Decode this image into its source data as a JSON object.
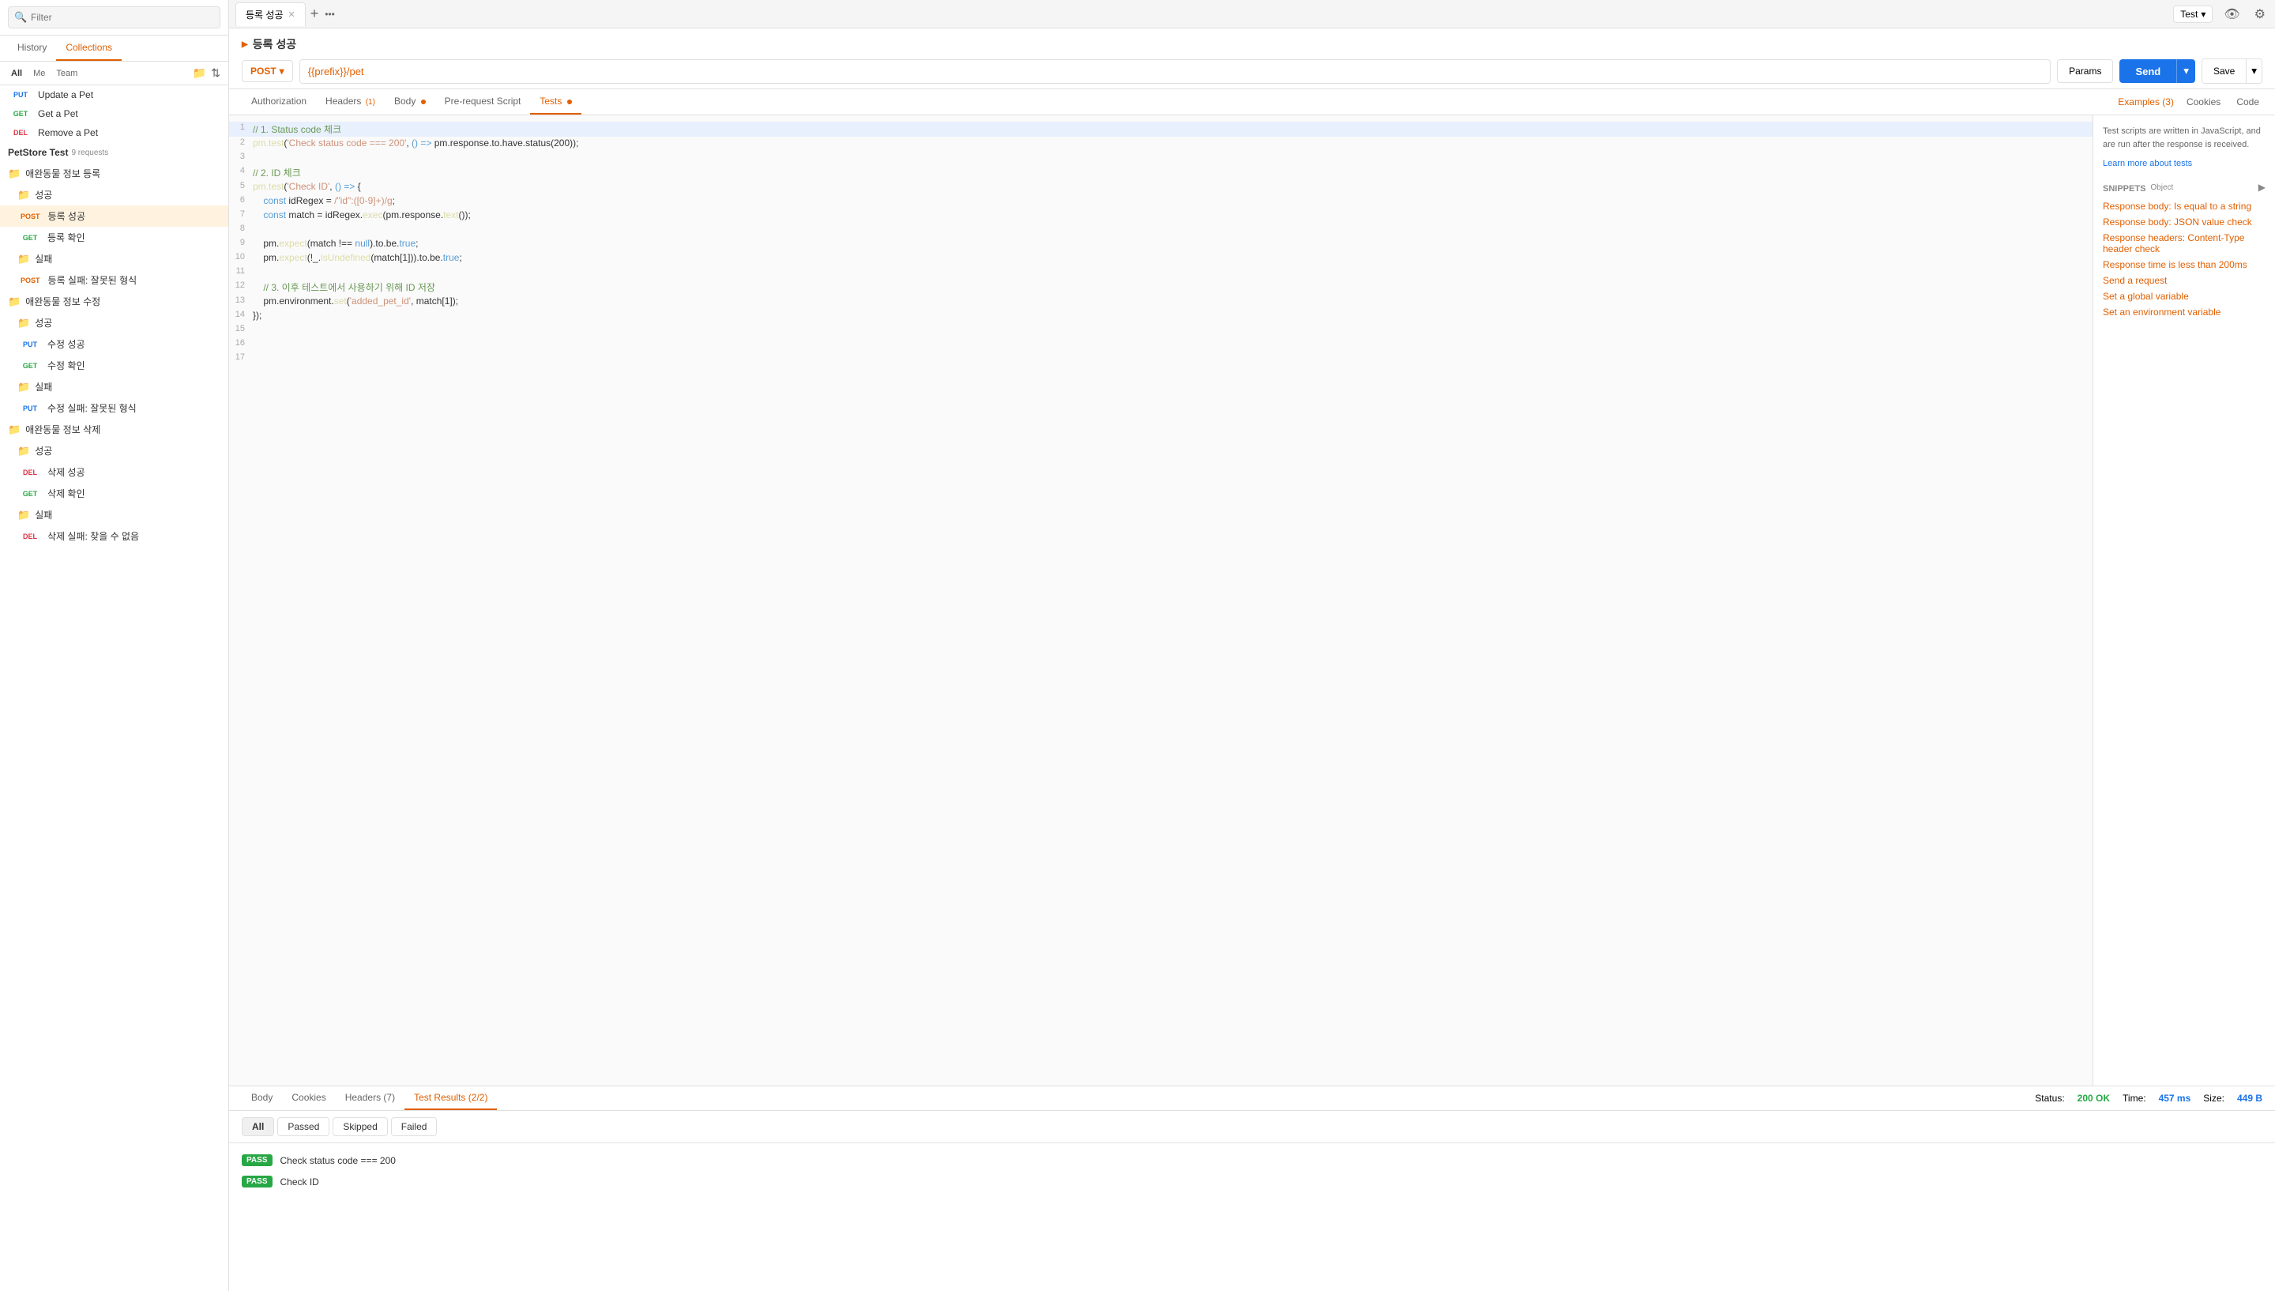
{
  "sidebar": {
    "search_placeholder": "Filter",
    "tabs": [
      {
        "label": "History",
        "active": false
      },
      {
        "label": "Collections",
        "active": true
      }
    ],
    "sub_tabs": [
      "All",
      "Me",
      "Team"
    ],
    "items": [
      {
        "type": "method",
        "method": "PUT",
        "name": "Update a Pet"
      },
      {
        "type": "method",
        "method": "GET",
        "name": "Get a Pet"
      },
      {
        "type": "method",
        "method": "DEL",
        "name": "Remove a Pet"
      },
      {
        "type": "section",
        "name": "PetStore Test",
        "count": "9 requests"
      },
      {
        "type": "folder",
        "name": "애완동물 정보 등록",
        "dots": true
      },
      {
        "type": "folder",
        "name": "성공"
      },
      {
        "type": "method",
        "method": "POST",
        "name": "등록 성공",
        "selected": true
      },
      {
        "type": "method",
        "method": "GET",
        "name": "등록 확인"
      },
      {
        "type": "folder",
        "name": "실패"
      },
      {
        "type": "method",
        "method": "POST",
        "name": "등록 실패: 잘못된 형식"
      },
      {
        "type": "folder",
        "name": "애완동물 정보 수정",
        "dots": true
      },
      {
        "type": "folder",
        "name": "성공",
        "dots": true
      },
      {
        "type": "method",
        "method": "PUT",
        "name": "수정 성공"
      },
      {
        "type": "method",
        "method": "GET",
        "name": "수정 확인"
      },
      {
        "type": "folder",
        "name": "실패",
        "dots": true
      },
      {
        "type": "method",
        "method": "PUT",
        "name": "수정 실패: 잘못된 형식"
      },
      {
        "type": "folder",
        "name": "애완동물 정보 삭제",
        "dots": true
      },
      {
        "type": "folder",
        "name": "성공",
        "dots": true
      },
      {
        "type": "method",
        "method": "DEL",
        "name": "삭제 성공"
      },
      {
        "type": "method",
        "method": "GET",
        "name": "삭제 확인"
      },
      {
        "type": "folder",
        "name": "실패"
      },
      {
        "type": "method",
        "method": "DEL",
        "name": "삭제 실패: 찾을 수 없음"
      }
    ]
  },
  "tabs": [
    {
      "label": "등록 성공",
      "active": true
    }
  ],
  "tab_add": "+",
  "tab_more": "•••",
  "env": {
    "label": "Test",
    "dropdown_icon": "▾"
  },
  "request": {
    "title": "등록 성공",
    "method": "POST",
    "url": "{{prefix}}/pet",
    "url_display": "{{prefix}}/pet",
    "params_label": "Params",
    "send_label": "Send",
    "save_label": "Save"
  },
  "req_tabs": [
    {
      "label": "Authorization",
      "active": false,
      "dot": false
    },
    {
      "label": "Headers",
      "active": false,
      "dot": false,
      "count": "1"
    },
    {
      "label": "Body",
      "active": false,
      "dot": true
    },
    {
      "label": "Pre-request Script",
      "active": false,
      "dot": false
    },
    {
      "label": "Tests",
      "active": true,
      "dot": true
    }
  ],
  "cookies_label": "Cookies",
  "code_label": "Code",
  "examples_label": "Examples (3)",
  "code_lines": [
    {
      "num": 1,
      "content": "// 1. Status code 체크",
      "type": "comment"
    },
    {
      "num": 2,
      "content": "pm.test('Check status code === 200', () => pm.response.to.have.status(200));",
      "type": "code"
    },
    {
      "num": 3,
      "content": "",
      "type": "empty"
    },
    {
      "num": 4,
      "content": "// 2. ID 체크",
      "type": "comment"
    },
    {
      "num": 5,
      "content": "pm.test('Check ID', () => {",
      "type": "code"
    },
    {
      "num": 6,
      "content": "    const idRegex = /\"id\":([0-9]+)/g;",
      "type": "code"
    },
    {
      "num": 7,
      "content": "    const match = idRegex.exec(pm.response.text());",
      "type": "code"
    },
    {
      "num": 8,
      "content": "",
      "type": "empty"
    },
    {
      "num": 9,
      "content": "    pm.expect(match !== null).to.be.true;",
      "type": "code"
    },
    {
      "num": 10,
      "content": "    pm.expect(!_.isUndefined(match[1])).to.be.true;",
      "type": "code"
    },
    {
      "num": 11,
      "content": "",
      "type": "empty"
    },
    {
      "num": 12,
      "content": "    // 3. 이후 테스트에서 사용하기 위해 ID 저장",
      "type": "comment"
    },
    {
      "num": 13,
      "content": "    pm.environment.set('added_pet_id', match[1]);",
      "type": "code"
    },
    {
      "num": 14,
      "content": "});",
      "type": "code"
    },
    {
      "num": 15,
      "content": "",
      "type": "empty"
    },
    {
      "num": 16,
      "content": "",
      "type": "empty"
    },
    {
      "num": 17,
      "content": "",
      "type": "empty"
    }
  ],
  "snippets": {
    "desc": "Test scripts are written in JavaScript, and are run after the response is received.",
    "learn_more": "Learn more about tests",
    "title": "SNIPPETS",
    "items": [
      "Response body: Is equal to a string",
      "Response body: JSON value check",
      "Response headers: Content-Type header check",
      "Response time is less than 200ms",
      "Send a request",
      "Set a global variable",
      "Set an environment variable"
    ]
  },
  "response": {
    "tabs": [
      "Body",
      "Cookies",
      "Headers (7)",
      "Test Results (2/2)"
    ],
    "active_tab": "Test Results (2/2)",
    "status": "200 OK",
    "time": "457 ms",
    "size": "449 B",
    "status_label": "Status:",
    "time_label": "Time:",
    "size_label": "Size:",
    "filter_tabs": [
      "All",
      "Passed",
      "Skipped",
      "Failed"
    ],
    "test_results": [
      {
        "status": "PASS",
        "name": "Check status code === 200"
      },
      {
        "status": "PASS",
        "name": "Check ID"
      }
    ]
  }
}
